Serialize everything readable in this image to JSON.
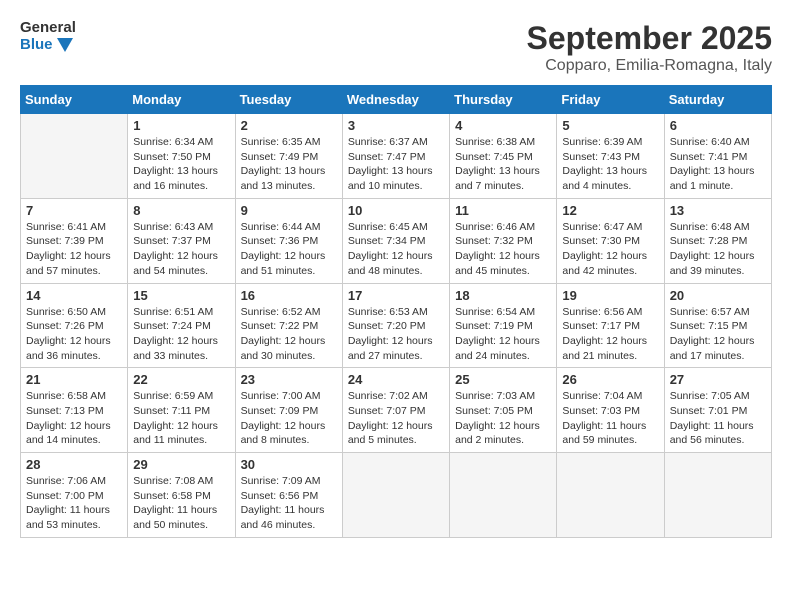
{
  "header": {
    "logo_line1": "General",
    "logo_line2": "Blue",
    "month": "September 2025",
    "location": "Copparo, Emilia-Romagna, Italy"
  },
  "weekdays": [
    "Sunday",
    "Monday",
    "Tuesday",
    "Wednesday",
    "Thursday",
    "Friday",
    "Saturday"
  ],
  "weeks": [
    [
      {
        "day": "",
        "info": ""
      },
      {
        "day": "1",
        "info": "Sunrise: 6:34 AM\nSunset: 7:50 PM\nDaylight: 13 hours\nand 16 minutes."
      },
      {
        "day": "2",
        "info": "Sunrise: 6:35 AM\nSunset: 7:49 PM\nDaylight: 13 hours\nand 13 minutes."
      },
      {
        "day": "3",
        "info": "Sunrise: 6:37 AM\nSunset: 7:47 PM\nDaylight: 13 hours\nand 10 minutes."
      },
      {
        "day": "4",
        "info": "Sunrise: 6:38 AM\nSunset: 7:45 PM\nDaylight: 13 hours\nand 7 minutes."
      },
      {
        "day": "5",
        "info": "Sunrise: 6:39 AM\nSunset: 7:43 PM\nDaylight: 13 hours\nand 4 minutes."
      },
      {
        "day": "6",
        "info": "Sunrise: 6:40 AM\nSunset: 7:41 PM\nDaylight: 13 hours\nand 1 minute."
      }
    ],
    [
      {
        "day": "7",
        "info": "Sunrise: 6:41 AM\nSunset: 7:39 PM\nDaylight: 12 hours\nand 57 minutes."
      },
      {
        "day": "8",
        "info": "Sunrise: 6:43 AM\nSunset: 7:37 PM\nDaylight: 12 hours\nand 54 minutes."
      },
      {
        "day": "9",
        "info": "Sunrise: 6:44 AM\nSunset: 7:36 PM\nDaylight: 12 hours\nand 51 minutes."
      },
      {
        "day": "10",
        "info": "Sunrise: 6:45 AM\nSunset: 7:34 PM\nDaylight: 12 hours\nand 48 minutes."
      },
      {
        "day": "11",
        "info": "Sunrise: 6:46 AM\nSunset: 7:32 PM\nDaylight: 12 hours\nand 45 minutes."
      },
      {
        "day": "12",
        "info": "Sunrise: 6:47 AM\nSunset: 7:30 PM\nDaylight: 12 hours\nand 42 minutes."
      },
      {
        "day": "13",
        "info": "Sunrise: 6:48 AM\nSunset: 7:28 PM\nDaylight: 12 hours\nand 39 minutes."
      }
    ],
    [
      {
        "day": "14",
        "info": "Sunrise: 6:50 AM\nSunset: 7:26 PM\nDaylight: 12 hours\nand 36 minutes."
      },
      {
        "day": "15",
        "info": "Sunrise: 6:51 AM\nSunset: 7:24 PM\nDaylight: 12 hours\nand 33 minutes."
      },
      {
        "day": "16",
        "info": "Sunrise: 6:52 AM\nSunset: 7:22 PM\nDaylight: 12 hours\nand 30 minutes."
      },
      {
        "day": "17",
        "info": "Sunrise: 6:53 AM\nSunset: 7:20 PM\nDaylight: 12 hours\nand 27 minutes."
      },
      {
        "day": "18",
        "info": "Sunrise: 6:54 AM\nSunset: 7:19 PM\nDaylight: 12 hours\nand 24 minutes."
      },
      {
        "day": "19",
        "info": "Sunrise: 6:56 AM\nSunset: 7:17 PM\nDaylight: 12 hours\nand 21 minutes."
      },
      {
        "day": "20",
        "info": "Sunrise: 6:57 AM\nSunset: 7:15 PM\nDaylight: 12 hours\nand 17 minutes."
      }
    ],
    [
      {
        "day": "21",
        "info": "Sunrise: 6:58 AM\nSunset: 7:13 PM\nDaylight: 12 hours\nand 14 minutes."
      },
      {
        "day": "22",
        "info": "Sunrise: 6:59 AM\nSunset: 7:11 PM\nDaylight: 12 hours\nand 11 minutes."
      },
      {
        "day": "23",
        "info": "Sunrise: 7:00 AM\nSunset: 7:09 PM\nDaylight: 12 hours\nand 8 minutes."
      },
      {
        "day": "24",
        "info": "Sunrise: 7:02 AM\nSunset: 7:07 PM\nDaylight: 12 hours\nand 5 minutes."
      },
      {
        "day": "25",
        "info": "Sunrise: 7:03 AM\nSunset: 7:05 PM\nDaylight: 12 hours\nand 2 minutes."
      },
      {
        "day": "26",
        "info": "Sunrise: 7:04 AM\nSunset: 7:03 PM\nDaylight: 11 hours\nand 59 minutes."
      },
      {
        "day": "27",
        "info": "Sunrise: 7:05 AM\nSunset: 7:01 PM\nDaylight: 11 hours\nand 56 minutes."
      }
    ],
    [
      {
        "day": "28",
        "info": "Sunrise: 7:06 AM\nSunset: 7:00 PM\nDaylight: 11 hours\nand 53 minutes."
      },
      {
        "day": "29",
        "info": "Sunrise: 7:08 AM\nSunset: 6:58 PM\nDaylight: 11 hours\nand 50 minutes."
      },
      {
        "day": "30",
        "info": "Sunrise: 7:09 AM\nSunset: 6:56 PM\nDaylight: 11 hours\nand 46 minutes."
      },
      {
        "day": "",
        "info": ""
      },
      {
        "day": "",
        "info": ""
      },
      {
        "day": "",
        "info": ""
      },
      {
        "day": "",
        "info": ""
      }
    ]
  ]
}
